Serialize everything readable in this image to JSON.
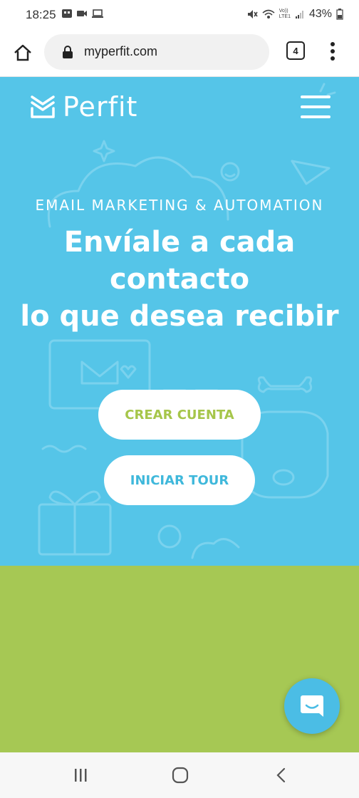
{
  "status_bar": {
    "time": "18:25",
    "battery": "43%",
    "network": "LTE1",
    "network_top": "Vo))",
    "icons": [
      "sim-icon",
      "video-icon",
      "laptop-icon",
      "mute-icon",
      "wifi-icon",
      "signal-icon",
      "battery-icon"
    ]
  },
  "browser": {
    "url": "myperfit.com",
    "tab_count": "4",
    "icons": [
      "home-icon",
      "lock-icon",
      "more-vert-icon"
    ]
  },
  "header": {
    "logo_text": "Perfit",
    "icons": [
      "perfit-logo-icon",
      "hamburger-icon"
    ]
  },
  "hero": {
    "tagline": "EMAIL MARKETING & AUTOMATION",
    "headline_line1": "Envíale a cada",
    "headline_line2": "contacto",
    "headline_line3": "lo que desea recibir",
    "btn_create": "CREAR CUENTA",
    "btn_tour": "INICIAR TOUR"
  },
  "chat": {
    "icon": "chat-icon"
  },
  "nav_bar": {
    "icons": [
      "recent-apps-icon",
      "home-nav-icon",
      "back-icon"
    ]
  },
  "colors": {
    "hero_bg": "#55c5e8",
    "green_bg": "#a6c854",
    "create_text": "#a6c64a",
    "tour_text": "#3fb8db",
    "chat_bg": "#4bbde5"
  }
}
